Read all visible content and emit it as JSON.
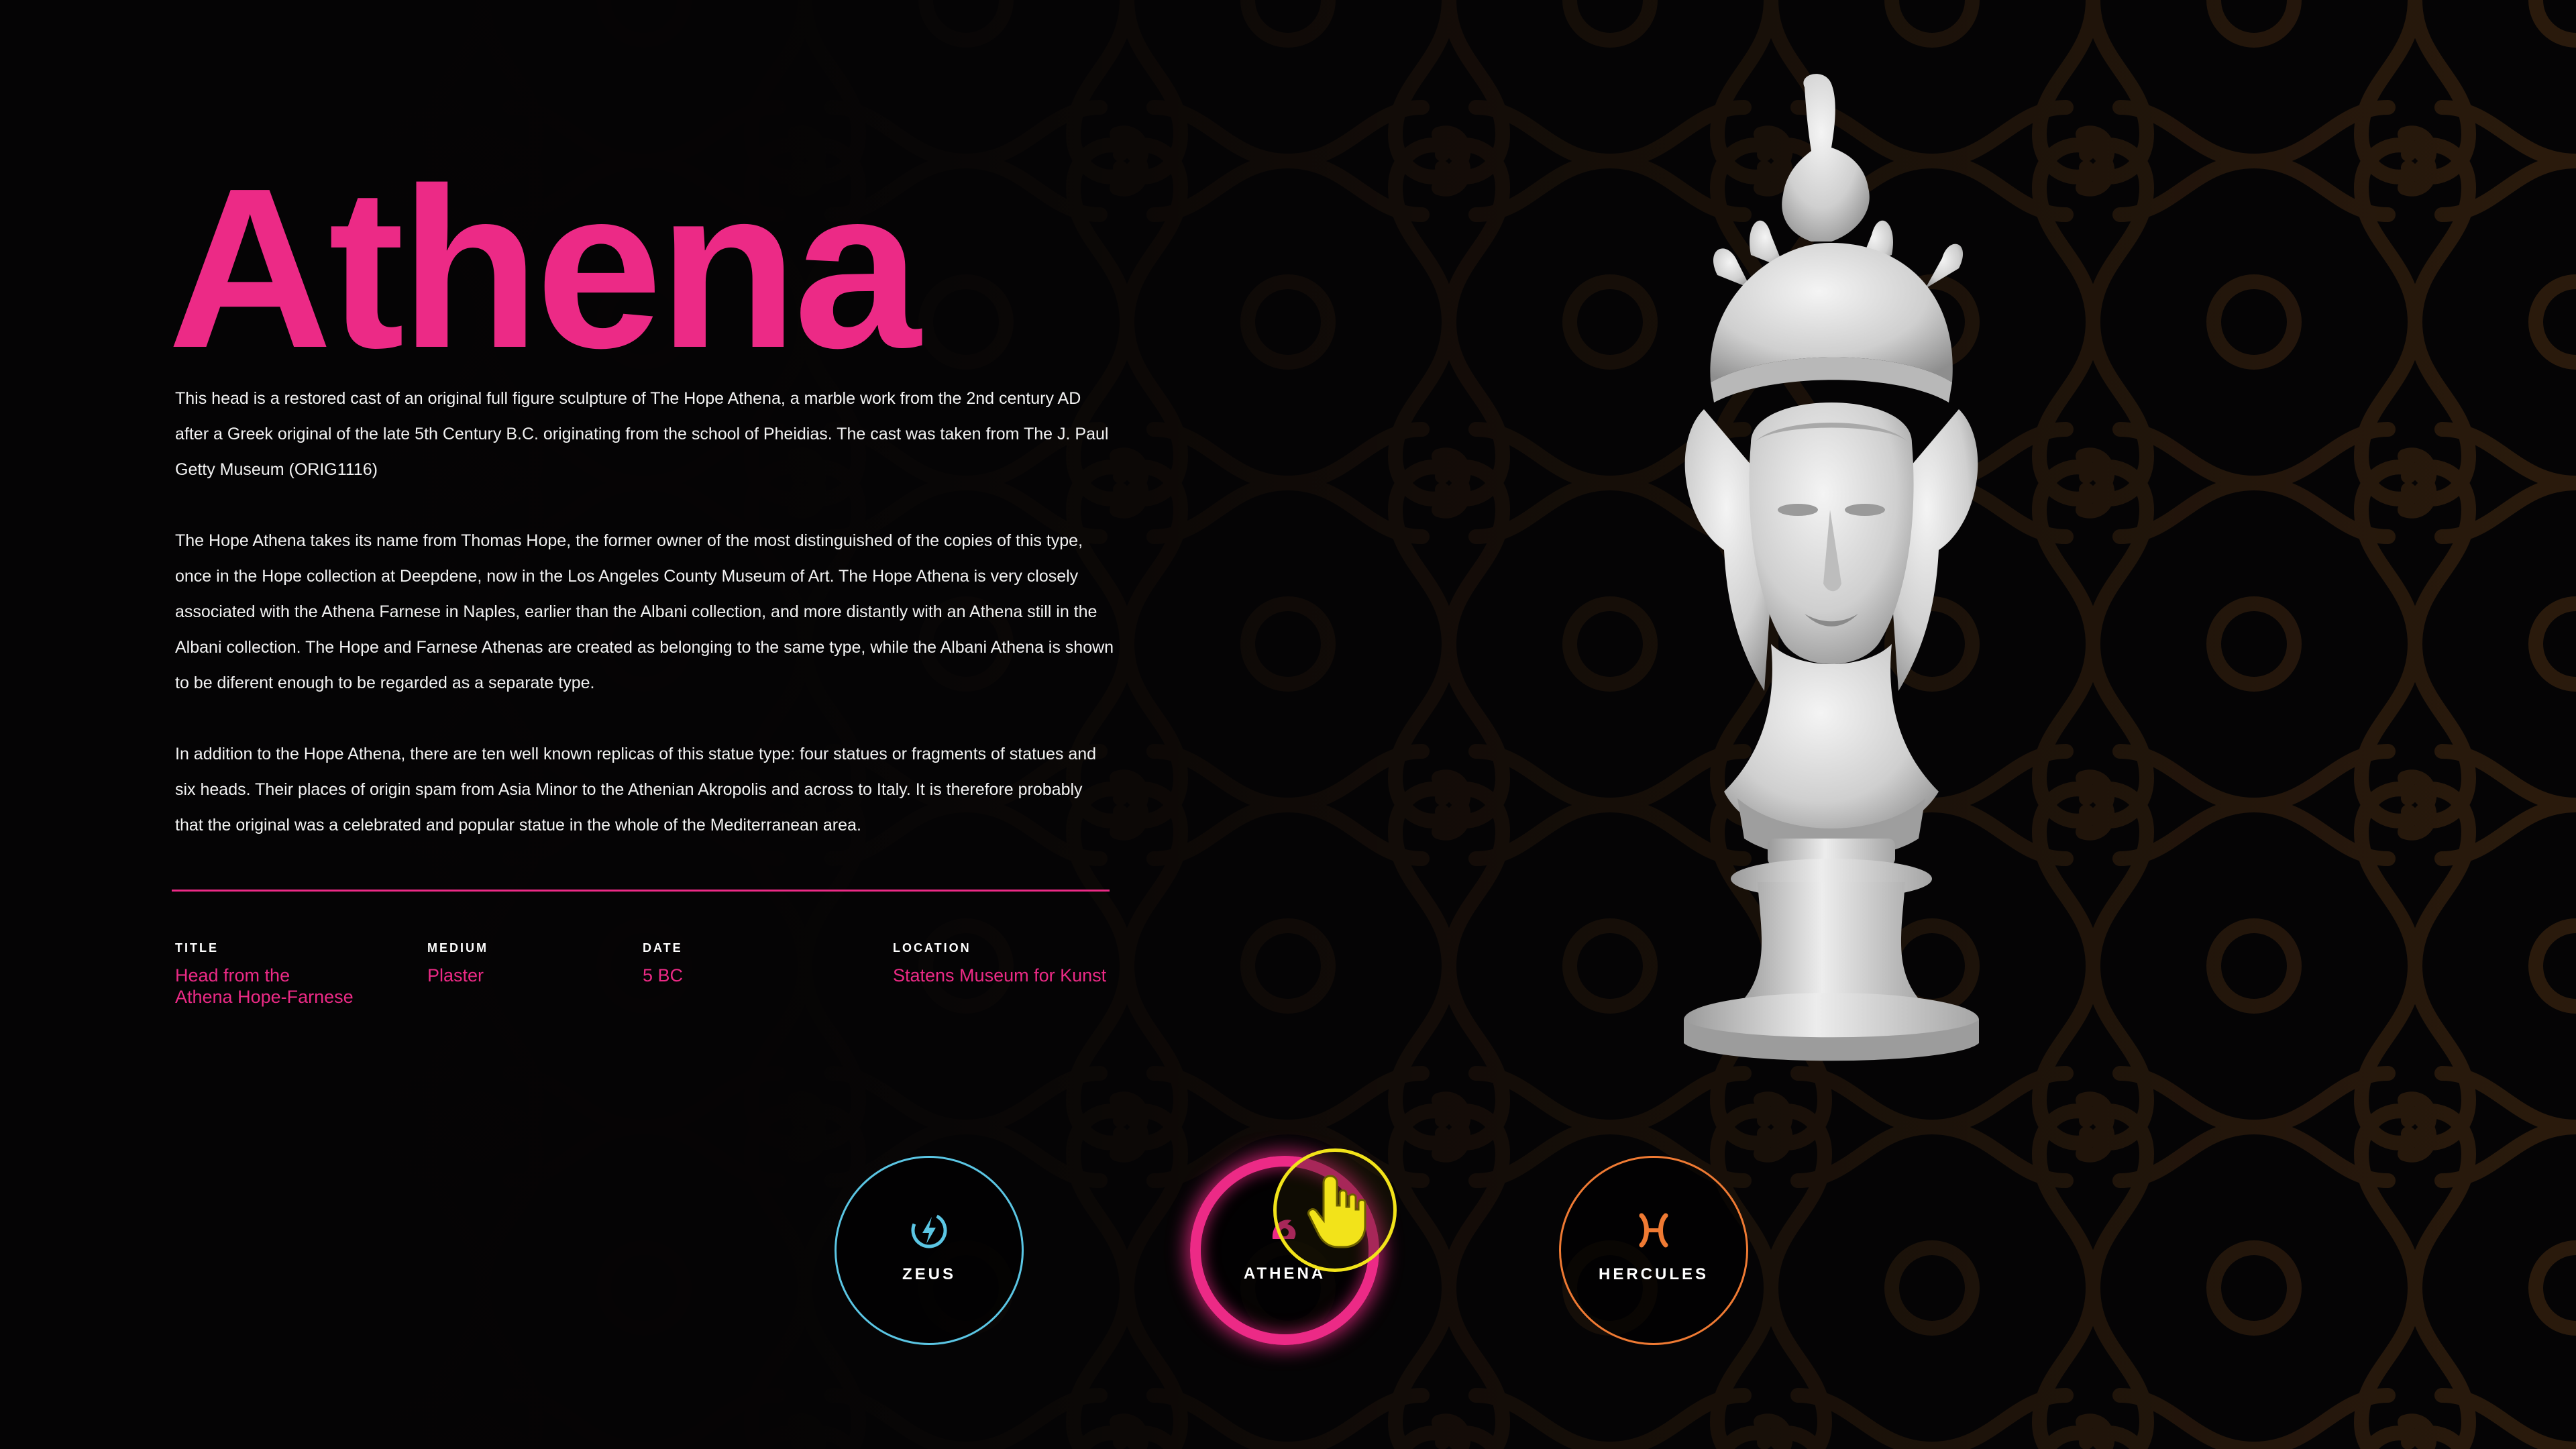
{
  "hero": {
    "title": "Athena"
  },
  "description": {
    "paragraphs": [
      "This head is a restored cast of an original full figure sculpture of The Hope Athena, a marble work from the 2nd century AD after a Greek original of the late 5th Century B.C. originating from the school of Pheidias. The cast was taken from The J. Paul Getty Museum (ORIG1116)",
      "The Hope Athena takes its name from Thomas Hope, the former owner of the most distinguished of the copies of this type, once in the Hope collection at Deepdene, now in the Los Angeles County Museum of Art. The Hope Athena is very closely associated with the Athena Farnese in Naples, earlier than the Albani collection, and more distantly with an Athena still in the Albani collection. The Hope and Farnese Athenas are created as belonging to the same type, while the Albani Athena is shown to be diferent enough to be regarded as a separate type.",
      "In addition to the Hope Athena, there are ten well known replicas of this statue type: four statues or fragments of statues and six heads. Their places of origin spam from Asia Minor to the Athenian Akropolis and across to Italy. It is therefore probably that the original was a celebrated and popular statue in the whole of the Mediterranean area."
    ]
  },
  "meta": {
    "title_label": "TITLE",
    "title_value_line1": "Head from the",
    "title_value_line2": "Athena Hope-Farnese",
    "medium_label": "MEDIUM",
    "medium_value": "Plaster",
    "date_label": "DATE",
    "date_value": "5 BC",
    "location_label": "LOCATION",
    "location_value": "Statens Museum for Kunst"
  },
  "nav": {
    "zeus": {
      "label": "ZEUS",
      "icon": "lightning-bolt-icon",
      "color": "#5bc6e4"
    },
    "athena": {
      "label": "ATHENA",
      "icon": "owl-icon",
      "color": "#ec2a86",
      "active": true
    },
    "hercules": {
      "label": "HERCULES",
      "icon": "hercules-h-icon",
      "color": "#ef7a33"
    }
  },
  "cursor": {
    "icon": "pointing-hand-icon",
    "color": "#f2e31a"
  },
  "statue": {
    "icon": "athena-bust-image"
  },
  "colors": {
    "accent": "#ec2a86",
    "background": "#050405",
    "pattern": "#3a2410"
  }
}
